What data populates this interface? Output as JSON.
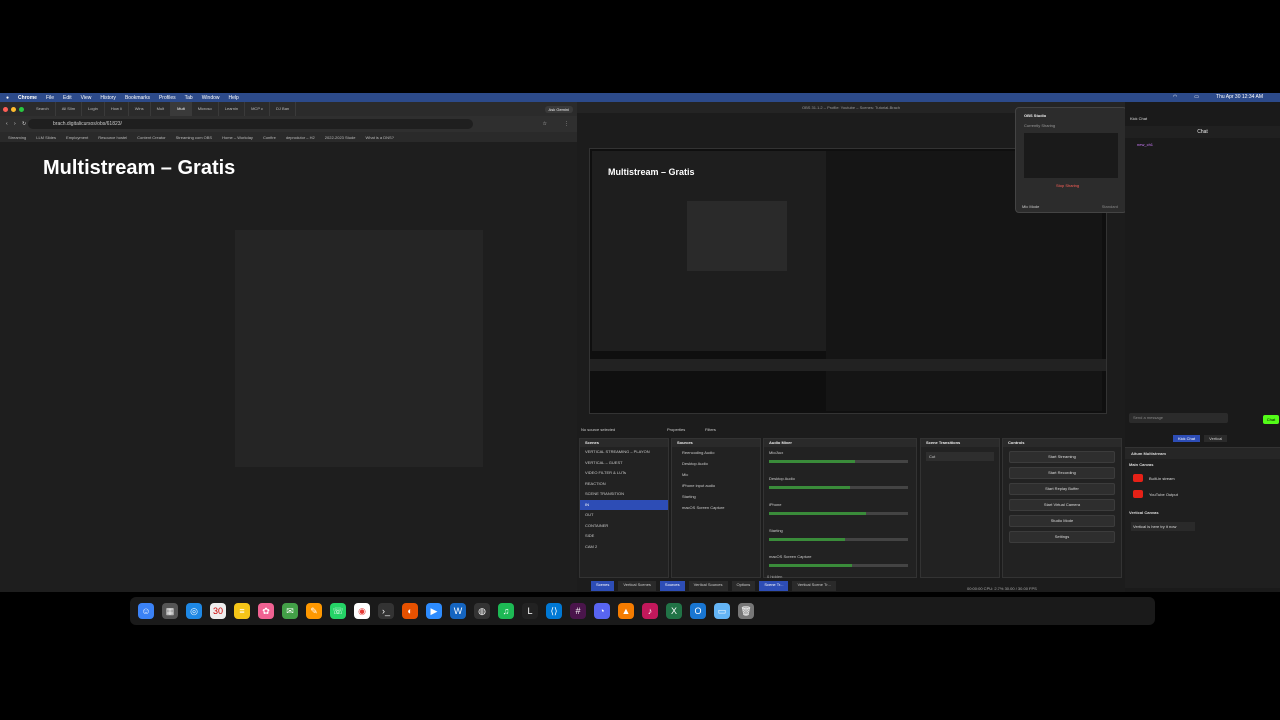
{
  "menubar": {
    "app": "Chrome",
    "items": [
      "File",
      "Edit",
      "View",
      "History",
      "Bookmarks",
      "Profiles",
      "Tab",
      "Window",
      "Help"
    ],
    "clock": "Thu Apr 30 12:34 AM"
  },
  "chrome": {
    "tabs": [
      "Search",
      "All Slim",
      "Login",
      "How li",
      "Wins",
      "Mult",
      "Mult",
      "Microso",
      "Learnin",
      "MCP c",
      "DJ Ban"
    ],
    "ask_label": "Ask Gemini",
    "url": "brach.digitalicursos/obs/61823/",
    "bookmarks": [
      "Streaming",
      "LLM Slides",
      "Employment",
      "Resource hostel",
      "Content Creator",
      "Streaming com OBS",
      "Home – Workday",
      "Confire",
      "deprodutor – H2",
      "2022-2023 Stude",
      "What is a DNS?"
    ],
    "slide_title": "Multistream – Gratis"
  },
  "obs": {
    "window_title": "OBS 31.1.2 – Profile: Youtube – Scenes: Tutorial-Brach",
    "inner_title": "Multistream – Gratis",
    "no_source": "No source selected",
    "properties": "Properties",
    "filters": "Filters",
    "scenes_header": "Scenes",
    "scenes": [
      "VERTICAL STREAMING – PLAYON",
      "VERTICAL – GUEST",
      "VIDEO FILTER & LUTs",
      "REACTION",
      "SCENE TRANSITION",
      "IN",
      "OUT",
      "CONTAINER",
      "SIDE",
      "CAM 2"
    ],
    "selected_scene": 5,
    "sources_header": "Sources",
    "sources": [
      "Reencoding Audio",
      "Desktop Audio",
      "Mic",
      "iPhone input audio",
      "Starting",
      "macOS Screen Capture"
    ],
    "mixer_header": "Audio Mixer",
    "mixer": [
      {
        "name": "Mic/Aux",
        "level": 0.62
      },
      {
        "name": "Desktop Audio",
        "level": 0.58
      },
      {
        "name": "iPhone",
        "level": 0.7
      },
      {
        "name": "Starting",
        "level": 0.55
      },
      {
        "name": "macOS Screen Capture",
        "level": 0.6
      }
    ],
    "transitions_header": "Scene Transitions",
    "transition_value": "Cut",
    "controls_header": "Controls",
    "controls": [
      "Start Streaming",
      "Start Recording",
      "Start Replay Buffer",
      "Start Virtual Camera",
      "Studio Mode",
      "Settings"
    ],
    "bottom_tabs": [
      "Scenes",
      "Vertical Scenes",
      "Sources",
      "Vertical Sources",
      "Options",
      "Scene Tr...",
      "Vertical Scene Tr..."
    ],
    "hotkeys": "0 hidden",
    "status": "00:00:00   CPU: 2.7%   30.00 / 30.00 FPS"
  },
  "screen_share": {
    "app": "OBS Studio",
    "label": "Currently Sharing",
    "stop": "Stop Sharing",
    "mic_mode": "Mic Mode",
    "mic_value": "Standard"
  },
  "kick": {
    "tab": "Kick Chat",
    "chat_header": "Chat",
    "user": "new_ch1",
    "input_placeholder": "Send a message",
    "chat_button": "Chat",
    "tabs": [
      "Kick Chat",
      "Vertical"
    ]
  },
  "aitum": {
    "title": "Aitum Multistream",
    "main_canvas": "Main Canvas",
    "outputs": [
      "Built-in stream",
      "YouTube Output"
    ],
    "vertical_canvas": "Vertical Canvas",
    "vertical_note": "Vertical is here try it now"
  },
  "dock": {
    "calendar_day": "30",
    "apps": [
      "finder-icon",
      "launchpad-icon",
      "safari-icon",
      "chrome-icon",
      "messages-icon",
      "whatsapp-icon",
      "zoom-icon",
      "vscode-icon",
      "obs-icon",
      "spotify-icon",
      "terminal-icon",
      "slack-icon",
      "excel-icon",
      "folder-icon",
      "trash-icon"
    ]
  }
}
